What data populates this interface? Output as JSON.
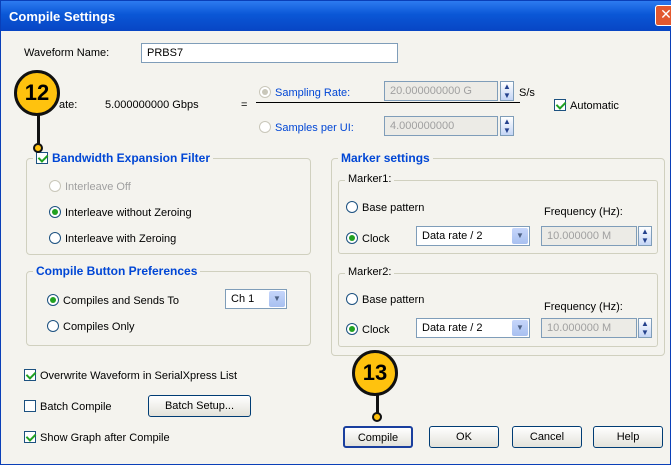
{
  "window": {
    "title": "Compile Settings",
    "close_glyph": "✕"
  },
  "waveform": {
    "label": "Waveform Name:",
    "value": "PRBS7"
  },
  "rate": {
    "label": "ate:",
    "value": "5.000000000 Gbps",
    "equals": "="
  },
  "sampling": {
    "rate_label": "Sampling Rate:",
    "rate_value": "20.000000000 G",
    "rate_unit": "S/s",
    "per_ui_label": "Samples per UI:",
    "per_ui_value": "4.000000000",
    "automatic_label": "Automatic"
  },
  "bandwidth": {
    "title": "Bandwidth Expansion Filter",
    "options": [
      "Interleave Off",
      "Interleave without Zeroing",
      "Interleave with Zeroing"
    ]
  },
  "compile_prefs": {
    "title": "Compile Button Preferences",
    "sends_label": "Compiles and Sends To",
    "channel": "Ch 1",
    "only_label": "Compiles Only"
  },
  "marker": {
    "title": "Marker settings",
    "marker1": {
      "title": "Marker1:",
      "base": "Base pattern",
      "clock": "Clock",
      "select": "Data rate / 2",
      "freq_label": "Frequency (Hz):",
      "freq": "10.000000 M"
    },
    "marker2": {
      "title": "Marker2:",
      "base": "Base pattern",
      "clock": "Clock",
      "select": "Data rate / 2",
      "freq_label": "Frequency (Hz):",
      "freq": "10.000000 M"
    }
  },
  "options": {
    "overwrite": "Overwrite Waveform in SerialXpress List",
    "batch_compile": "Batch Compile",
    "batch_setup": "Batch Setup...",
    "show_graph": "Show Graph after Compile"
  },
  "buttons": {
    "compile": "Compile",
    "ok": "OK",
    "cancel": "Cancel",
    "help": "Help"
  },
  "callouts": {
    "c12": "12",
    "c13": "13"
  },
  "colors": {
    "title_bar": "#0a57d6",
    "group_title": "#0046d5",
    "callout": "#ffc20e",
    "check": "#21a121"
  }
}
